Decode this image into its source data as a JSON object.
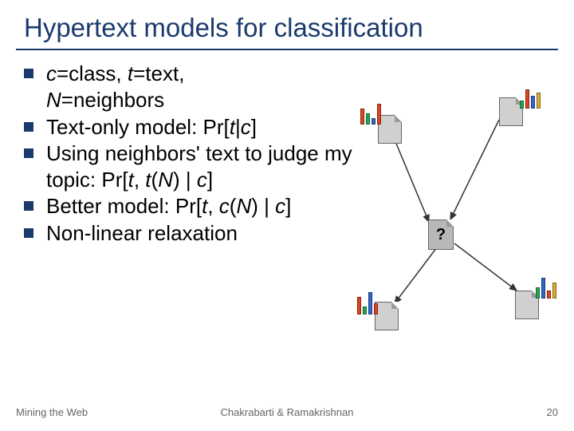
{
  "title": "Hypertext models for classification",
  "bullets": {
    "b1a": "c",
    "b1b": "=class, ",
    "b1c": "t",
    "b1d": "=text,",
    "b1e": "N",
    "b1f": "=neighbors",
    "b2a": "Text-only model: Pr[",
    "b2b": "t",
    "b2c": "|",
    "b2d": "c",
    "b2e": "]",
    "b3a": "Using neighbors' text to judge my topic: Pr[",
    "b3b": "t",
    "b3c": ", ",
    "b3d": "t",
    "b3e": "(",
    "b3f": "N",
    "b3g": ") | ",
    "b3h": "c",
    "b3i": "]",
    "b4a": "Better model: Pr[",
    "b4b": "t",
    "b4c": ", ",
    "b4d": "c",
    "b4e": "(",
    "b4f": "N",
    "b4g": ") | ",
    "b4h": "c",
    "b4i": "]",
    "b5": "Non-linear relaxation"
  },
  "center_q": "?",
  "footer": {
    "left": "Mining the Web",
    "center": "Chakrabarti & Ramakrishnan",
    "right": "20"
  }
}
